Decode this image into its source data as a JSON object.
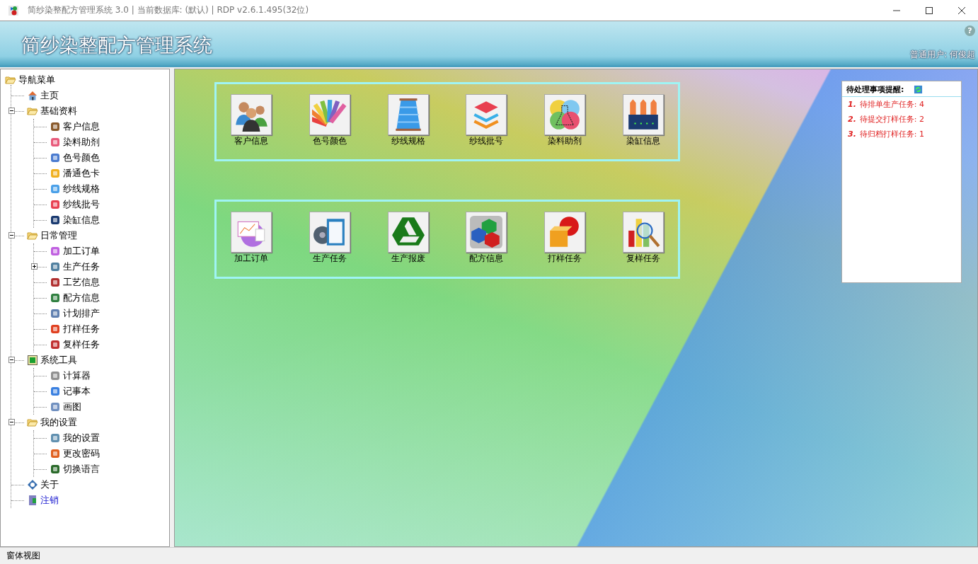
{
  "window": {
    "title": "简纱染整配方管理系统 3.0 | 当前数据库: (默认) | RDP v2.6.1.495(32位)"
  },
  "header": {
    "title": "简纱染整配方管理系统",
    "help": "?",
    "user": "普通用户: 何俊超"
  },
  "nav": {
    "label": "导航菜单",
    "children": [
      {
        "label": "主页",
        "kind": "home"
      },
      {
        "label": "基础资料",
        "kind": "folder",
        "expanded": true,
        "children": [
          {
            "label": "客户信息",
            "kind": "people"
          },
          {
            "label": "染料助剂",
            "kind": "flask"
          },
          {
            "label": "色号颜色",
            "kind": "palette"
          },
          {
            "label": "潘通色卡",
            "kind": "dots"
          },
          {
            "label": "纱线规格",
            "kind": "spool"
          },
          {
            "label": "纱线批号",
            "kind": "layers"
          },
          {
            "label": "染缸信息",
            "kind": "machine"
          }
        ]
      },
      {
        "label": "日常管理",
        "kind": "folder",
        "expanded": true,
        "children": [
          {
            "label": "加工订单",
            "kind": "order"
          },
          {
            "label": "生产任务",
            "kind": "clipboard",
            "expanded": false
          },
          {
            "label": "工艺信息",
            "kind": "thermo"
          },
          {
            "label": "配方信息",
            "kind": "cubes"
          },
          {
            "label": "计划排产",
            "kind": "doc"
          },
          {
            "label": "打样任务",
            "kind": "sphere"
          },
          {
            "label": "复样任务",
            "kind": "magnifier"
          }
        ]
      },
      {
        "label": "系统工具",
        "kind": "tools",
        "expanded": true,
        "children": [
          {
            "label": "计算器",
            "kind": "calculator"
          },
          {
            "label": "记事本",
            "kind": "notepad"
          },
          {
            "label": "画图",
            "kind": "paint"
          }
        ]
      },
      {
        "label": "我的设置",
        "kind": "folder",
        "expanded": true,
        "children": [
          {
            "label": "我的设置",
            "kind": "gears"
          },
          {
            "label": "更改密码",
            "kind": "user"
          },
          {
            "label": "切换语言",
            "kind": "language"
          }
        ]
      },
      {
        "label": "关于",
        "kind": "about"
      },
      {
        "label": "注销",
        "kind": "logout"
      }
    ]
  },
  "tile_groups": [
    [
      {
        "label": "客户信息",
        "kind": "people"
      },
      {
        "label": "色号颜色",
        "kind": "palette"
      },
      {
        "label": "纱线规格",
        "kind": "spool"
      },
      {
        "label": "纱线批号",
        "kind": "layers"
      },
      {
        "label": "染料助剂",
        "kind": "flask"
      },
      {
        "label": "染缸信息",
        "kind": "machine"
      }
    ],
    [
      {
        "label": "加工订单",
        "kind": "order"
      },
      {
        "label": "生产任务",
        "kind": "clipboard"
      },
      {
        "label": "生产报废",
        "kind": "triangle"
      },
      {
        "label": "配方信息",
        "kind": "cubes"
      },
      {
        "label": "打样任务",
        "kind": "sphere"
      },
      {
        "label": "复样任务",
        "kind": "magnifier"
      }
    ]
  ],
  "reminders": {
    "title": "待处理事项提醒:",
    "items": [
      {
        "number": "1.",
        "text": "待排单生产任务: 4"
      },
      {
        "number": "2.",
        "text": "待提交打样任务: 2"
      },
      {
        "number": "3.",
        "text": "待归档打样任务: 1"
      }
    ]
  },
  "status_bar": "窗体视图"
}
